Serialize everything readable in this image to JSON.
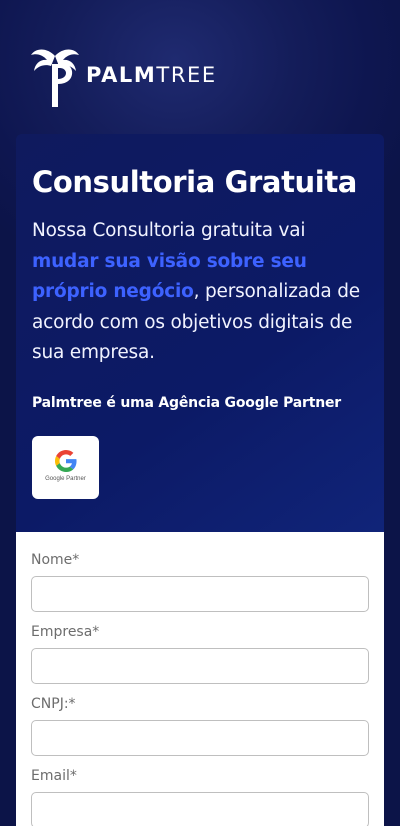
{
  "brand": {
    "name_bold": "PALM",
    "name_light": "TREE",
    "logo_icon": "palm-tree-icon"
  },
  "hero": {
    "title": "Consultoria Gratuita",
    "description_before": "Nossa Consultoria gratuita vai ",
    "description_highlight": "mudar sua visão sobre seu próprio negócio",
    "description_after": ", personalizada de acordo com os objetivos digitais de sua empresa.",
    "partner_text": "Palmtree é uma Agência Google Partner",
    "badge_label": "Google Partner",
    "badge_icon": "google-g-icon"
  },
  "colors": {
    "background": "#0e1650",
    "card": "#0c1a66",
    "highlight": "#3d62ff",
    "form_background": "#ffffff"
  },
  "form": {
    "fields": [
      {
        "label": "Nome*",
        "value": ""
      },
      {
        "label": "Empresa*",
        "value": ""
      },
      {
        "label": "CNPJ:*",
        "value": ""
      },
      {
        "label": "Email*",
        "value": ""
      }
    ]
  }
}
